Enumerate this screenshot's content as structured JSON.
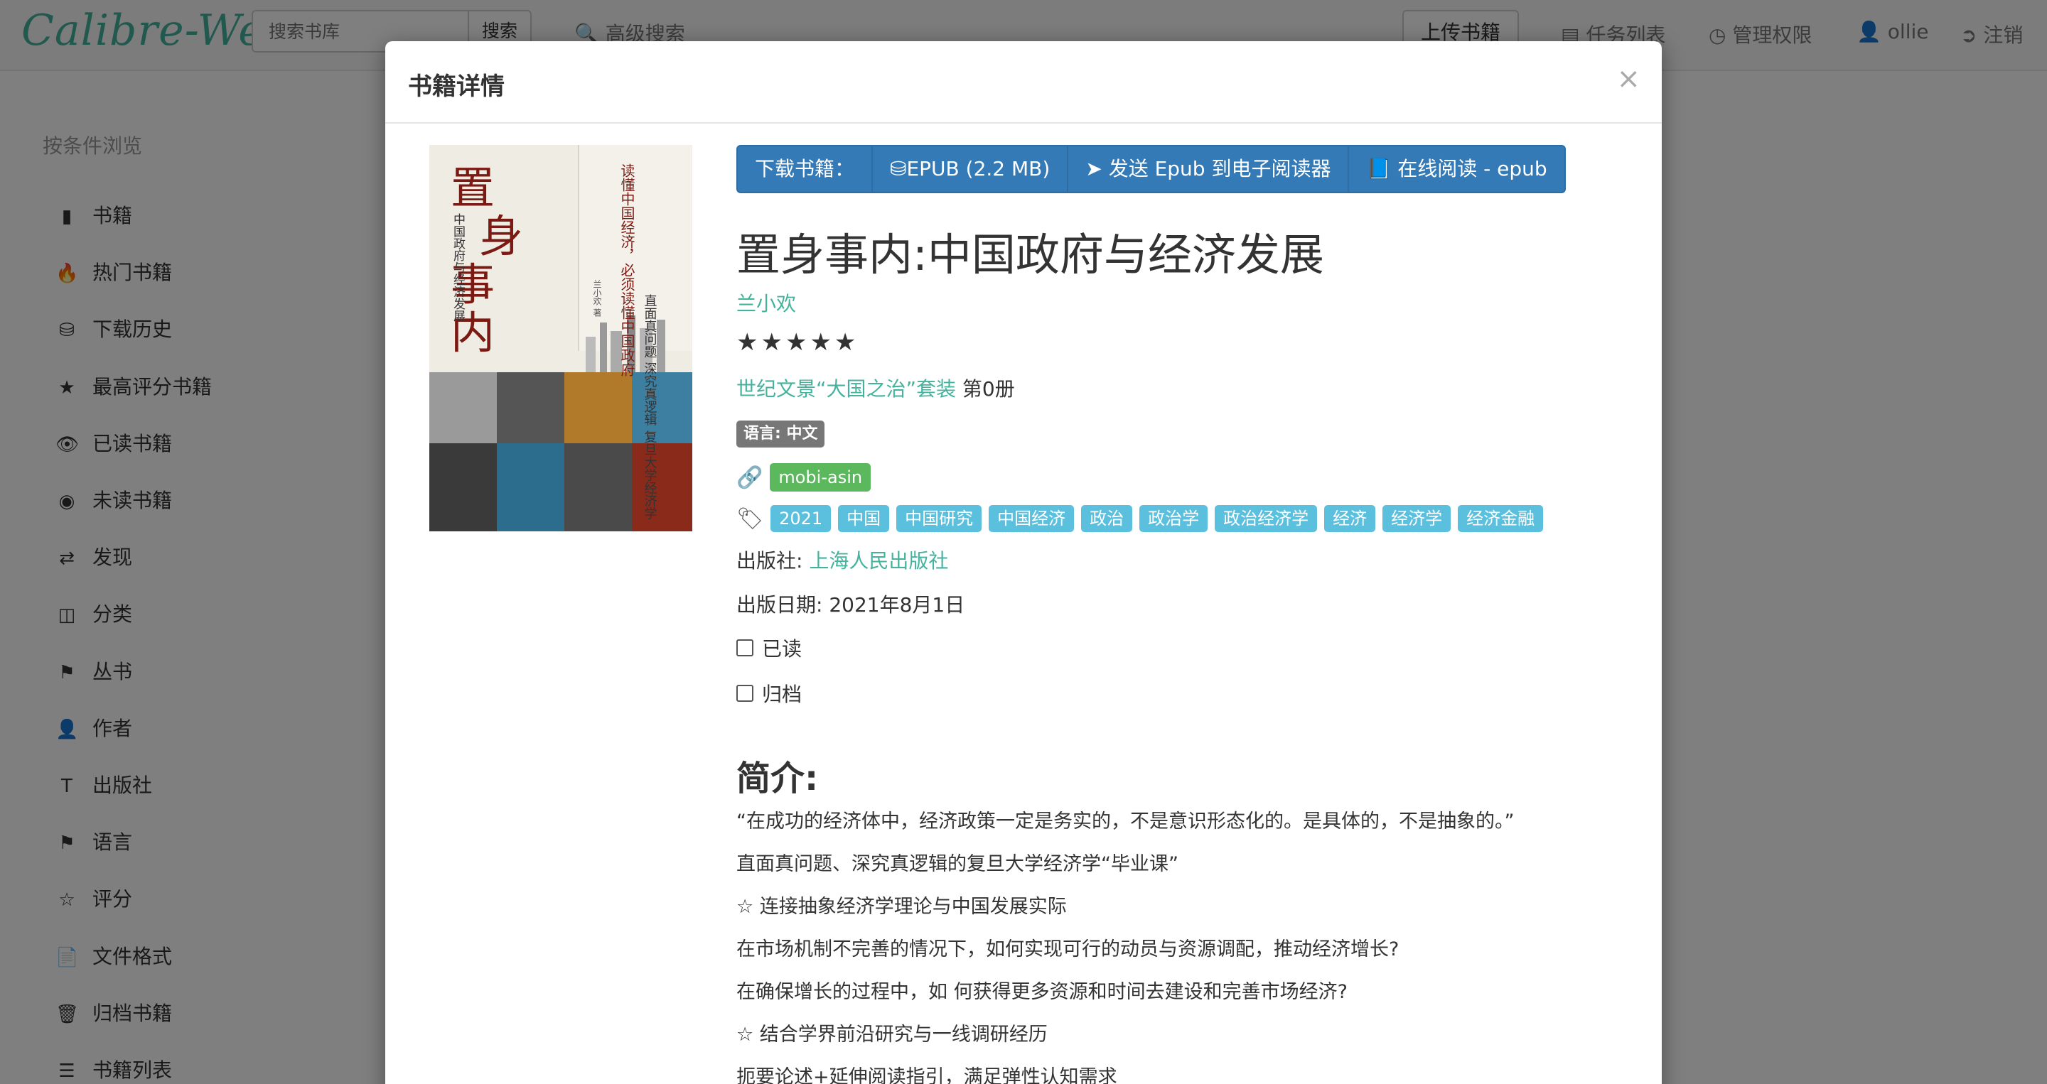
{
  "navbar": {
    "logo": "Calibre-Web",
    "search_placeholder": "搜索书库",
    "search_button": "搜索",
    "advanced_search": "高级搜索",
    "upload": "上传书籍",
    "tasks": "任务列表",
    "admin": "管理权限",
    "user": "ollie",
    "logout": "注销"
  },
  "sidebar": {
    "heading": "按条件浏览",
    "items": [
      {
        "icon": "book-icon",
        "label": "书籍"
      },
      {
        "icon": "fire-icon",
        "label": "热门书籍"
      },
      {
        "icon": "download-history-icon",
        "label": "下载历史"
      },
      {
        "icon": "star-icon",
        "label": "最高评分书籍"
      },
      {
        "icon": "eye-icon",
        "label": "已读书籍"
      },
      {
        "icon": "eye-slash-icon",
        "label": "未读书籍"
      },
      {
        "icon": "random-icon",
        "label": "发现"
      },
      {
        "icon": "inbox-icon",
        "label": "分类"
      },
      {
        "icon": "bookmark-icon",
        "label": "丛书"
      },
      {
        "icon": "user-icon",
        "label": "作者"
      },
      {
        "icon": "text-size-icon",
        "label": "出版社"
      },
      {
        "icon": "flag-icon",
        "label": "语言"
      },
      {
        "icon": "star-empty-icon",
        "label": "评分"
      },
      {
        "icon": "file-icon",
        "label": "文件格式"
      },
      {
        "icon": "trash-icon",
        "label": "归档书籍"
      },
      {
        "icon": "list-icon",
        "label": "书籍列表"
      }
    ]
  },
  "modal": {
    "title": "书籍详情",
    "close": "×",
    "cover": {
      "title_chars": [
        "置",
        "身",
        "事",
        "内"
      ],
      "subtitle": "中国政府与经济发展",
      "tagline": "读懂中国经济，必须读懂中国政府",
      "side_text": "直面真问题 深究真逻辑 复旦大学经济学",
      "author": "兰小欢 著"
    },
    "download": {
      "label": "下载书籍：",
      "epub": "EPUB (2.2 MB)",
      "send": "发送 Epub 到电子阅读器",
      "read": "在线阅读 - epub"
    },
    "book": {
      "title": "置身事内:中国政府与经济发展",
      "author": "兰小欢",
      "rating": 5,
      "stars": "★★★★★",
      "series_link": "世纪文景“大国之治”套装",
      "series_index": "第0册",
      "language": "语言: 中文",
      "identifier": "mobi-asin",
      "tags": [
        "2021",
        "中国",
        "中国研究",
        "中国经济",
        "政治",
        "政治学",
        "政治经济学",
        "经济",
        "经济学",
        "经济金融"
      ],
      "publisher_label": "出版社: ",
      "publisher": "上海人民出版社",
      "pubdate": "出版日期: 2021年8月1日",
      "read_label": "已读",
      "archived_label": "归档"
    },
    "description": {
      "heading": "简介:",
      "lines": [
        "“在成功的经济体中，经济政策一定是务实的，不是意识形态化的。是具体的，不是抽象的。”",
        "直面真问题、深究真逻辑的复旦大学经济学“毕业课”",
        "☆ 连接抽象经济学理论与中国发展实际",
        "在市场机制不完善的情况下，如何实现可行的动员与资源调配，推动经济增长?",
        "在确保增长的过程中，如 何获得更多资源和时间去建设和完善市场经济?",
        "☆ 结合学界前沿研究与一线调研经历",
        "扼要论述+延伸阅读指引，满足弹性认知需求"
      ]
    }
  },
  "colors": {
    "accent": "#45b29d",
    "primary": "#337ab7",
    "tag": "#5bc0de",
    "identifier": "#5cb85c",
    "language": "#777777"
  }
}
